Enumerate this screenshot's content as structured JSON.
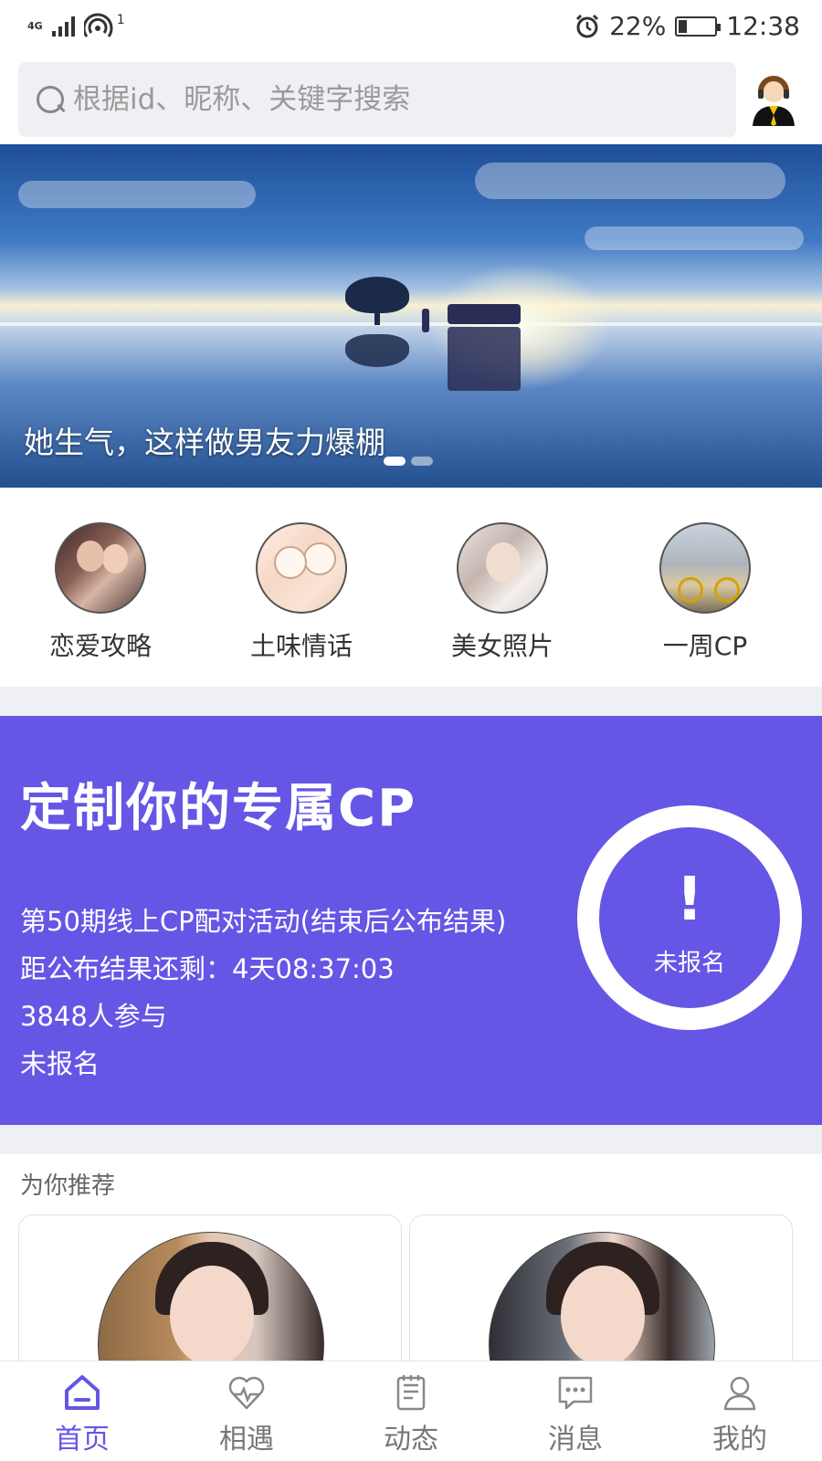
{
  "status_bar": {
    "network_label": "4G",
    "hotspot_count": "1",
    "battery_text": "22%",
    "time": "12:38",
    "icons": [
      "signal-icon",
      "wifi-hotspot-icon",
      "alarm-icon",
      "battery-icon"
    ]
  },
  "search": {
    "placeholder": "根据id、昵称、关键字搜索"
  },
  "banner": {
    "caption": "她生气，这样做男友力爆棚",
    "slide_count": 2,
    "active_slide": 1
  },
  "categories": [
    {
      "label": "恋爱攻略",
      "icon": "couple-photo"
    },
    {
      "label": "土味情话",
      "icon": "cartoon-couple"
    },
    {
      "label": "美女照片",
      "icon": "girl-photo"
    },
    {
      "label": "一周CP",
      "icon": "bicycle-couple"
    }
  ],
  "cp_card": {
    "title": "定制你的专属CP",
    "event": "第50期线上CP配对活动(结束后公布结果)",
    "countdown": "距公布结果还剩：4天08:37:03",
    "participants": "3848人参与",
    "signup_status": "未报名",
    "badge_symbol": "!",
    "badge_status": "未报名",
    "color": "#6556e6"
  },
  "recommend": {
    "title": "为你推荐"
  },
  "bottom_nav": {
    "items": [
      {
        "label": "首页",
        "icon": "home-icon"
      },
      {
        "label": "相遇",
        "icon": "heart-pulse-icon"
      },
      {
        "label": "动态",
        "icon": "notepad-icon"
      },
      {
        "label": "消息",
        "icon": "chat-icon"
      },
      {
        "label": "我的",
        "icon": "user-icon"
      }
    ],
    "active_index": 0,
    "accent": "#6556e6"
  }
}
